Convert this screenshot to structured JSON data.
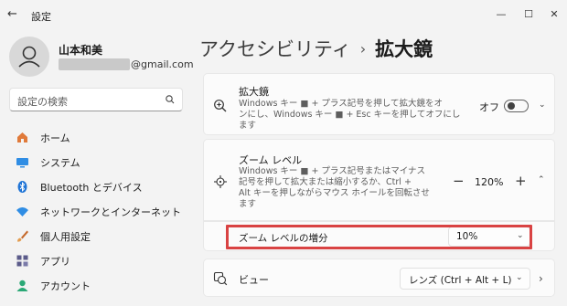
{
  "window": {
    "app_title": "設定",
    "back_icon": "arrow-left-icon",
    "minimize_icon": "minimize-icon",
    "maximize_icon": "maximize-icon",
    "close_icon": "close-icon"
  },
  "profile": {
    "name": "山本和美",
    "email_domain": "@gmail.com"
  },
  "search": {
    "placeholder": "設定の検索",
    "icon": "search-icon"
  },
  "nav": {
    "items": [
      {
        "label": "ホーム",
        "icon": "home-icon"
      },
      {
        "label": "システム",
        "icon": "system-icon"
      },
      {
        "label": "Bluetooth とデバイス",
        "icon": "bluetooth-icon"
      },
      {
        "label": "ネットワークとインターネット",
        "icon": "network-icon"
      },
      {
        "label": "個人用設定",
        "icon": "brush-icon"
      },
      {
        "label": "アプリ",
        "icon": "apps-icon"
      },
      {
        "label": "アカウント",
        "icon": "account-icon"
      }
    ]
  },
  "breadcrumb": {
    "parent": "アクセシビリティ",
    "separator": "›",
    "current": "拡大鏡"
  },
  "magnifier": {
    "title": "拡大鏡",
    "desc_line1": "Windows キー ■ + プラス記号を押して拡大鏡をオ",
    "desc_line2": "ンにし、Windows キー ■ + Esc キーを押してオフにし",
    "desc_line3": "ます",
    "toggle_label": "オフ",
    "toggle_on": false
  },
  "zoom": {
    "title": "ズーム レベル",
    "desc_line1": "Windows キー ■ + プラス記号またはマイナス",
    "desc_line2": "記号を押して拡大または縮小するか、Ctrl +",
    "desc_line3": "Alt キーを押しながらマウス ホイールを回転させ",
    "desc_line4": "ます",
    "minus": "−",
    "value": "120%",
    "plus": "+",
    "increment_label": "ズーム レベルの増分",
    "increment_value": "10%"
  },
  "view": {
    "title": "ビュー",
    "selected": "レンズ (Ctrl + Alt + L)"
  },
  "colors": {
    "highlight": "#d94343",
    "accent": "#0067c0"
  }
}
